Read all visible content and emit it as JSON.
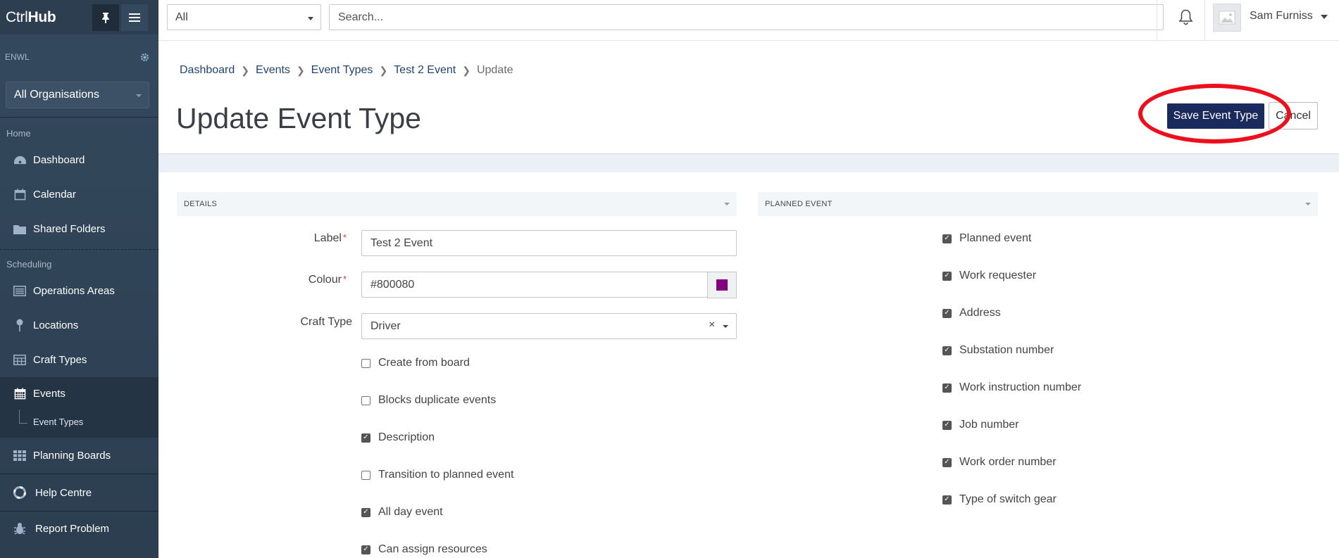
{
  "sidebar": {
    "logo_ctrl": "Ctrl",
    "logo_hub": "Hub",
    "org_label": "ENWL",
    "org_select": "All Organisations",
    "home_section": "Home",
    "scheduling_section": "Scheduling",
    "items": [
      {
        "label": "Dashboard",
        "icon": "dashboard-icon"
      },
      {
        "label": "Calendar",
        "icon": "calendar-icon"
      },
      {
        "label": "Shared Folders",
        "icon": "folder-icon"
      },
      {
        "label": "Operations Areas",
        "icon": "list-icon"
      },
      {
        "label": "Locations",
        "icon": "pin-icon"
      },
      {
        "label": "Craft Types",
        "icon": "table-icon"
      },
      {
        "label": "Events",
        "icon": "calendar-grid-icon"
      },
      {
        "label": "Planning Boards",
        "icon": "grid-icon"
      },
      {
        "label": "Help Centre",
        "icon": "lifebuoy-icon"
      },
      {
        "label": "Report Problem",
        "icon": "bug-icon"
      }
    ],
    "sub_item": "Event Types"
  },
  "topbar": {
    "scope": "All",
    "search_placeholder": "Search...",
    "username": "Sam Furniss"
  },
  "breadcrumb": [
    "Dashboard",
    "Events",
    "Event Types",
    "Test 2 Event",
    "Update"
  ],
  "page_title": "Update Event Type",
  "actions": {
    "save": "Save Event Type",
    "cancel": "Cancel"
  },
  "details": {
    "header": "DETAILS",
    "label_field": {
      "label": "Label",
      "value": "Test 2 Event"
    },
    "colour_field": {
      "label": "Colour",
      "value": "#800080"
    },
    "craft_field": {
      "label": "Craft Type",
      "value": "Driver"
    },
    "checkboxes": [
      {
        "label": "Create from board",
        "checked": false
      },
      {
        "label": "Blocks duplicate events",
        "checked": false
      },
      {
        "label": "Description",
        "checked": true
      },
      {
        "label": "Transition to planned event",
        "checked": false
      },
      {
        "label": "All day event",
        "checked": true
      },
      {
        "label": "Can assign resources",
        "checked": true
      }
    ]
  },
  "planned": {
    "header": "PLANNED EVENT",
    "checkboxes": [
      {
        "label": "Planned event",
        "checked": true
      },
      {
        "label": "Work requester",
        "checked": true
      },
      {
        "label": "Address",
        "checked": true
      },
      {
        "label": "Substation number",
        "checked": true
      },
      {
        "label": "Work instruction number",
        "checked": true
      },
      {
        "label": "Job number",
        "checked": true
      },
      {
        "label": "Work order number",
        "checked": true
      },
      {
        "label": "Type of switch gear",
        "checked": true
      }
    ]
  },
  "colors": {
    "sidebar": "#2c3e50",
    "primary_button": "#1b2a5c",
    "annotation": "#ee0f1c",
    "swatch": "#800080"
  }
}
